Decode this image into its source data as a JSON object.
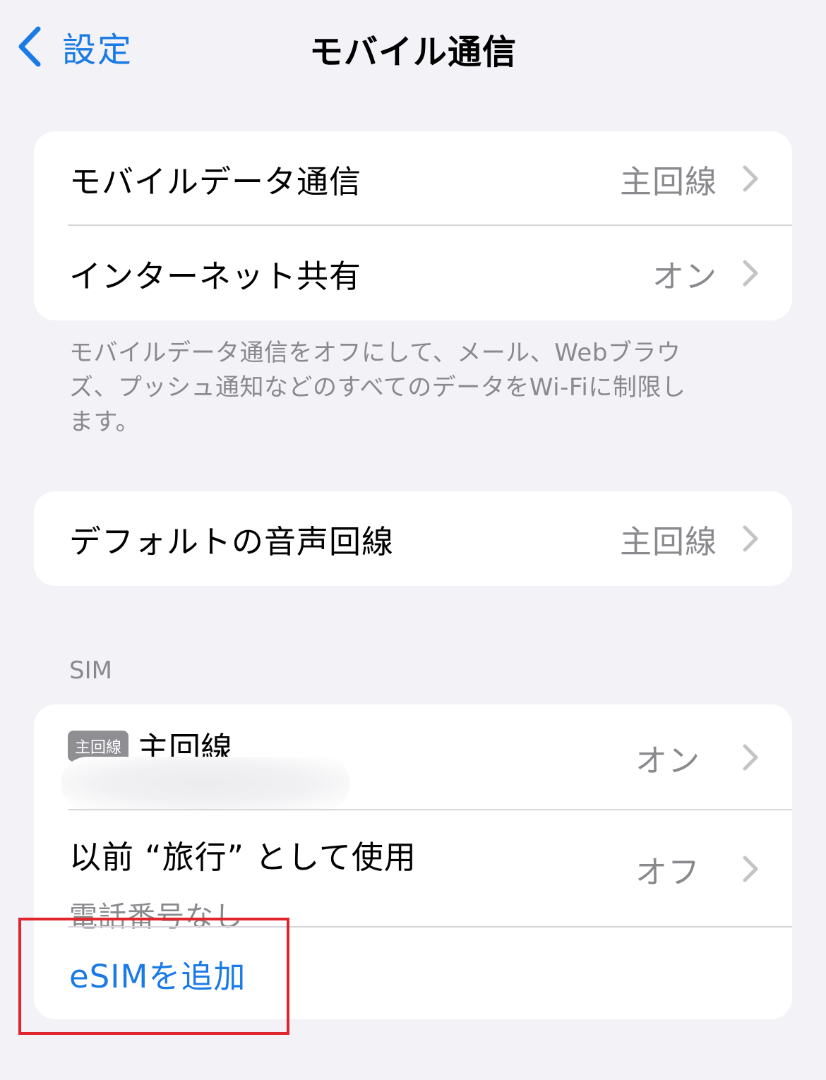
{
  "nav": {
    "back_label": "設定",
    "title": "モバイル通信"
  },
  "group1": {
    "rows": [
      {
        "label": "モバイルデータ通信",
        "value": "主回線"
      },
      {
        "label": "インターネット共有",
        "value": "オン"
      }
    ],
    "footer": "モバイルデータ通信をオフにして、メール、Webブラウズ、プッシュ通知などのすべてのデータをWi-Fiに制限します。"
  },
  "group2": {
    "rows": [
      {
        "label": "デフォルトの音声回線",
        "value": "主回線"
      }
    ]
  },
  "sim_section": {
    "header": "SIM",
    "primary": {
      "badge": "主回線",
      "name": "主回線",
      "value": "オン"
    },
    "previous": {
      "label": "以前 “旅行” として使用",
      "sublabel": "電話番号なし",
      "value": "オフ"
    },
    "add_esim_label": "eSIMを追加"
  },
  "colors": {
    "accent": "#1a7ae6",
    "background": "#f2f2f7",
    "highlight": "#e0262d"
  }
}
